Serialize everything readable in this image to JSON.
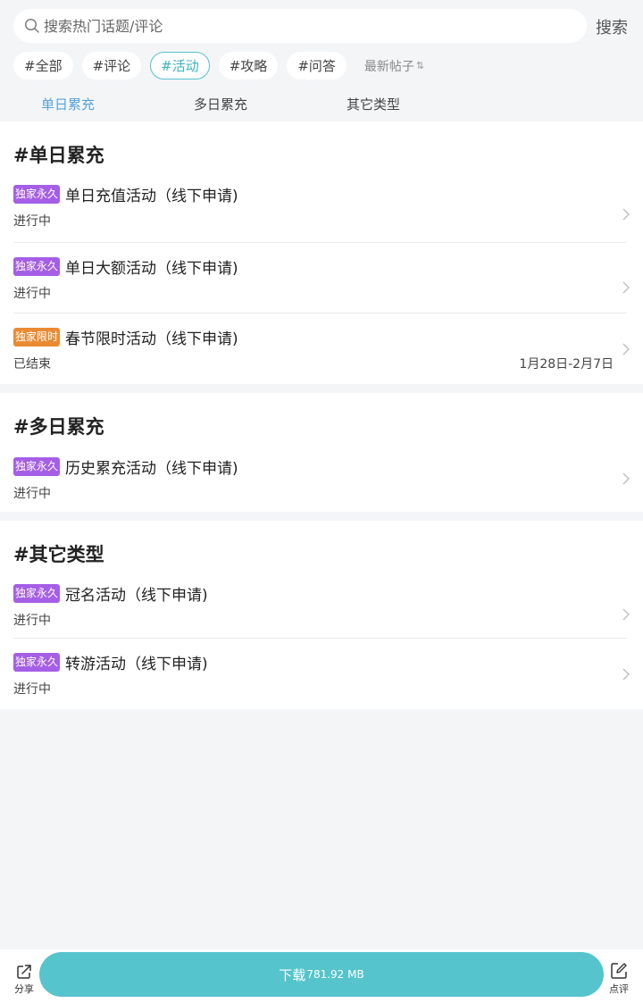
{
  "search": {
    "placeholder": "搜索热门话题/评论",
    "button_label": "搜索"
  },
  "filters": [
    {
      "label": "#全部",
      "active": false
    },
    {
      "label": "#评论",
      "active": false
    },
    {
      "label": "#活动",
      "active": true
    },
    {
      "label": "#攻略",
      "active": false
    },
    {
      "label": "#问答",
      "active": false
    }
  ],
  "sort_label": "最新帖子",
  "sort_icon": "sort-arrows-icon",
  "subtabs": [
    {
      "label": "单日累充",
      "active": true
    },
    {
      "label": "多日累充",
      "active": false
    },
    {
      "label": "其它类型",
      "active": false
    }
  ],
  "sections": [
    {
      "title": "#单日累充",
      "items": [
        {
          "tag": "独家永久",
          "tag_color": "#a55ee6",
          "title": "单日充值活动（线下申请)",
          "status": "进行中",
          "date": ""
        },
        {
          "tag": "独家永久",
          "tag_color": "#a55ee6",
          "title": "单日大额活动（线下申请)",
          "status": "进行中",
          "date": ""
        },
        {
          "tag": "独家限时",
          "tag_color": "#ea8b33",
          "title": "春节限时活动（线下申请)",
          "status": "已结束",
          "date": "1月28日-2月7日"
        }
      ]
    },
    {
      "title": "#多日累充",
      "items": [
        {
          "tag": "独家永久",
          "tag_color": "#a55ee6",
          "title": "历史累充活动（线下申请)",
          "status": "进行中",
          "date": ""
        }
      ]
    },
    {
      "title": "#其它类型",
      "items": [
        {
          "tag": "独家永久",
          "tag_color": "#a55ee6",
          "title": "冠名活动（线下申请)",
          "status": "进行中",
          "date": ""
        },
        {
          "tag": "独家永久",
          "tag_color": "#a55ee6",
          "title": "转游活动（线下申请)",
          "status": "进行中",
          "date": ""
        }
      ]
    }
  ],
  "bottom": {
    "share_label": "分享",
    "download_label": "下载",
    "download_size": "781.92 MB",
    "review_label": "点评"
  },
  "colors": {
    "accent": "#55c4cc",
    "active_tab": "#56a3d9",
    "tag_purple": "#a55ee6",
    "tag_orange": "#ea8b33"
  }
}
